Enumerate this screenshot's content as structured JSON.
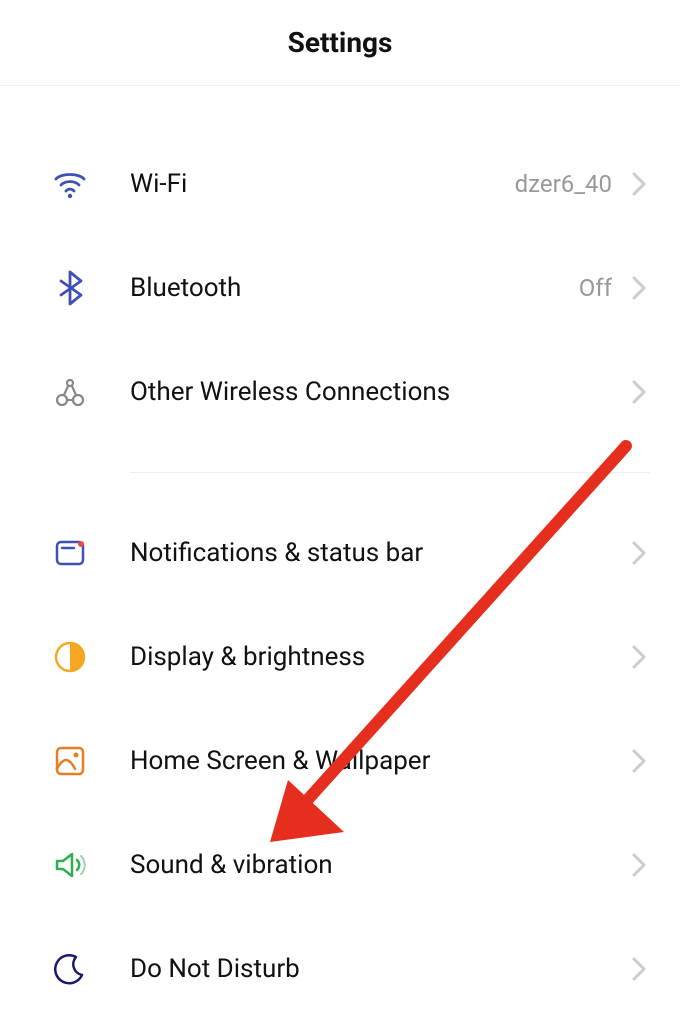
{
  "header": {
    "title": "Settings"
  },
  "groups": [
    {
      "items": [
        {
          "key": "wifi",
          "label": "Wi-Fi",
          "value": "dzer6_40",
          "icon": "wifi",
          "iconColor": "#3F51B5"
        },
        {
          "key": "bluetooth",
          "label": "Bluetooth",
          "value": "Off",
          "icon": "bluetooth",
          "iconColor": "#3F51B5"
        },
        {
          "key": "other-wireless",
          "label": "Other Wireless Connections",
          "value": "",
          "icon": "network",
          "iconColor": "#888"
        }
      ]
    },
    {
      "items": [
        {
          "key": "notifications",
          "label": "Notifications & status bar",
          "value": "",
          "icon": "status",
          "iconColor": "#3F51B5"
        },
        {
          "key": "display",
          "label": "Display & brightness",
          "value": "",
          "icon": "brightness",
          "iconColor": "#F5A623"
        },
        {
          "key": "home-screen",
          "label": "Home Screen & Wallpaper",
          "value": "",
          "icon": "wallpaper",
          "iconColor": "#E67E22"
        },
        {
          "key": "sound",
          "label": "Sound & vibration",
          "value": "",
          "icon": "sound",
          "iconColor": "#2BAF4F"
        },
        {
          "key": "dnd",
          "label": "Do Not Disturb",
          "value": "",
          "icon": "moon",
          "iconColor": "#1A1A70"
        }
      ]
    }
  ],
  "annotation": {
    "arrowColor": "#E62E1F"
  }
}
